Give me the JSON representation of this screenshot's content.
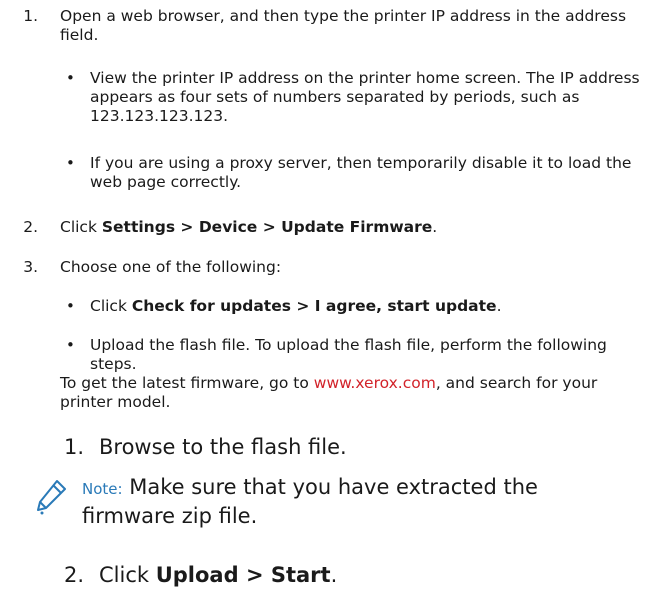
{
  "steps": [
    {
      "number": "1.",
      "text": "Open a web browser, and then type the printer IP address in the address field.",
      "bullets": [
        "View the printer IP address on the printer home screen. The IP address appears as four sets of numbers separated by periods, such as 123.123.123.123.",
        "If you are using a proxy server, then temporarily disable it to load the web page correctly."
      ]
    },
    {
      "number": "2.",
      "prefix": "Click ",
      "bold": "Settings > Device > Update Firmware",
      "suffix": "."
    },
    {
      "number": "3.",
      "text": "Choose one of the following:",
      "bullet_a": {
        "prefix": "Click ",
        "bold": "Check for updates > I agree, start update",
        "suffix": "."
      },
      "bullet_b": "Upload the flash file. To upload the flash file, perform the following steps.",
      "firmware_prefix": "To get the latest firmware, go to ",
      "firmware_link": "www.xerox.com",
      "firmware_suffix": ", and search for your printer model."
    }
  ],
  "substeps": [
    {
      "number": "1.",
      "text": "Browse to the flash file."
    },
    {
      "number": "2.",
      "prefix": "Click ",
      "bold": "Upload > Start",
      "suffix": "."
    }
  ],
  "note": {
    "label": "Note:",
    "text": " Make sure that you have extracted the firmware zip file.",
    "icon": "pencil-icon",
    "color": "#2a7ab8"
  },
  "colors": {
    "link": "#d2232a",
    "text": "#1a1a1a"
  }
}
